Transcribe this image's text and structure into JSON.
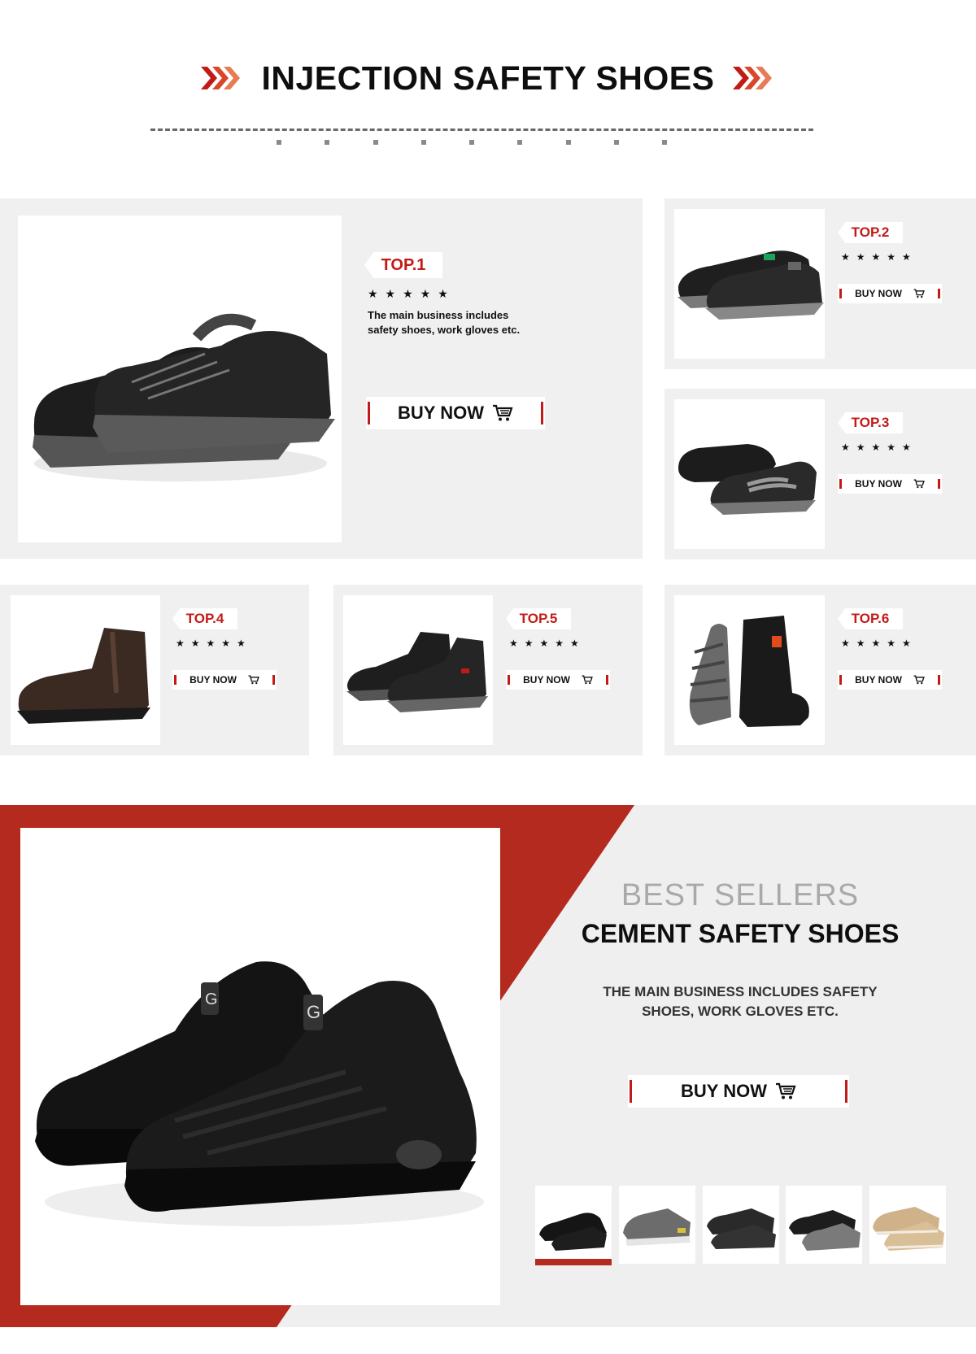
{
  "header": {
    "title": "INJECTION SAFETY SHOES"
  },
  "top1": {
    "rank": "TOP.1",
    "stars": "★★★★★",
    "desc": "The main business includes safety shoes, work gloves etc.",
    "buy": "BUY NOW"
  },
  "small": [
    {
      "rank": "TOP.2",
      "stars": "★★★★★",
      "buy": "BUY NOW"
    },
    {
      "rank": "TOP.3",
      "stars": "★★★★★",
      "buy": "BUY NOW"
    },
    {
      "rank": "TOP.4",
      "stars": "★★★★★",
      "buy": "BUY NOW"
    },
    {
      "rank": "TOP.5",
      "stars": "★★★★★",
      "buy": "BUY NOW"
    },
    {
      "rank": "TOP.6",
      "stars": "★★★★★",
      "buy": "BUY NOW"
    }
  ],
  "bestsellers": {
    "label": "BEST SELLERS",
    "title": "CEMENT SAFETY SHOES",
    "desc_line1": "THE MAIN BUSINESS INCLUDES SAFETY",
    "desc_line2": "SHOES, WORK GLOVES ETC.",
    "buy": "BUY NOW",
    "selected_thumb": 1
  },
  "colors": {
    "accent": "#c21b17",
    "brand_red": "#b52a1e",
    "panel": "#f0f0f0"
  },
  "icons": [
    "chevrons-right-icon",
    "star-icon",
    "cart-icon",
    "shoe-image"
  ]
}
